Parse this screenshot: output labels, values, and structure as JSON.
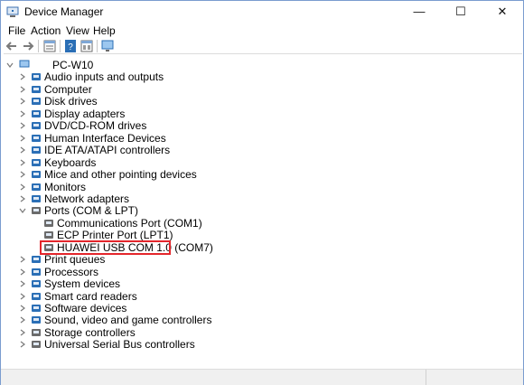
{
  "window": {
    "title": "Device Manager",
    "controls": {
      "minimize": "—",
      "maximize": "☐",
      "close": "✕"
    }
  },
  "menu": [
    {
      "label": "File"
    },
    {
      "label": "Action"
    },
    {
      "label": "View"
    },
    {
      "label": "Help"
    }
  ],
  "toolbar": {
    "icons": [
      "back-arrow-icon",
      "forward-arrow-icon",
      "properties-icon",
      "help-icon",
      "view-icon",
      "monitor-icon"
    ]
  },
  "tree": {
    "root": "PC-W10",
    "categories": [
      {
        "label": "Audio inputs and outputs",
        "icon": "speaker-icon"
      },
      {
        "label": "Computer",
        "icon": "computer-icon"
      },
      {
        "label": "Disk drives",
        "icon": "disk-icon"
      },
      {
        "label": "Display adapters",
        "icon": "display-icon"
      },
      {
        "label": "DVD/CD-ROM drives",
        "icon": "dvd-icon"
      },
      {
        "label": "Human Interface Devices",
        "icon": "hid-icon"
      },
      {
        "label": "IDE ATA/ATAPI controllers",
        "icon": "ide-icon"
      },
      {
        "label": "Keyboards",
        "icon": "keyboard-icon"
      },
      {
        "label": "Mice and other pointing devices",
        "icon": "mouse-icon"
      },
      {
        "label": "Monitors",
        "icon": "monitor-icon"
      },
      {
        "label": "Network adapters",
        "icon": "network-icon"
      },
      {
        "label": "Ports (COM & LPT)",
        "icon": "port-icon",
        "expanded": true,
        "children": [
          {
            "label": "Communications Port (COM1)"
          },
          {
            "label": "ECP Printer Port (LPT1)"
          },
          {
            "label": "HUAWEI USB COM 1.0 (COM7)",
            "highlighted": true
          }
        ]
      },
      {
        "label": "Print queues",
        "icon": "printer-icon"
      },
      {
        "label": "Processors",
        "icon": "processor-icon"
      },
      {
        "label": "System devices",
        "icon": "system-icon"
      },
      {
        "label": "Smart card readers",
        "icon": "smartcard-icon"
      },
      {
        "label": "Software devices",
        "icon": "software-icon"
      },
      {
        "label": "Sound, video and game controllers",
        "icon": "sound-icon"
      },
      {
        "label": "Storage controllers",
        "icon": "storage-icon"
      },
      {
        "label": "Universal Serial Bus controllers",
        "icon": "usb-icon"
      }
    ]
  },
  "colors": {
    "highlight_border": "#e4262c",
    "icon_blue": "#2b6fb6",
    "icon_gray": "#6b6b6b",
    "chevron": "#7a7a7a"
  }
}
